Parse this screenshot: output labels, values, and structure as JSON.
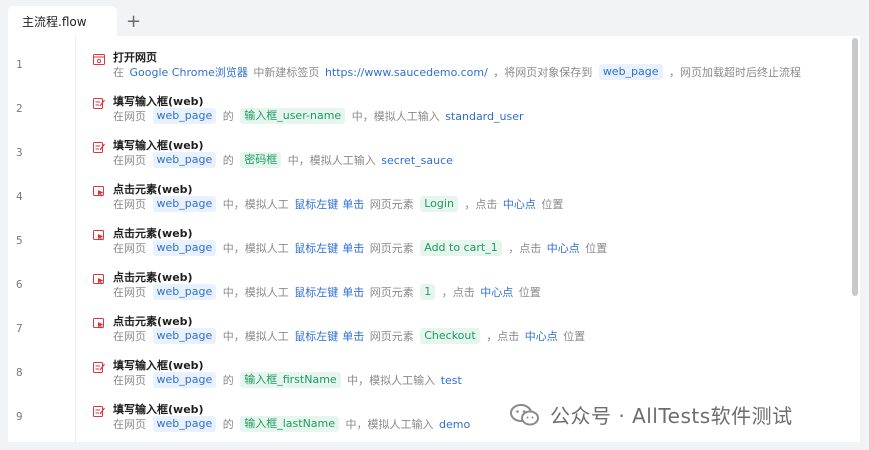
{
  "tabs": [
    {
      "label": "主流程.flow"
    }
  ],
  "tab_add": "+",
  "rows": [
    {
      "line": "1",
      "icon": "browser-icon",
      "title": "打开网页",
      "desc": [
        {
          "t": "text",
          "v": "在 "
        },
        {
          "t": "link",
          "v": "Google Chrome浏览器"
        },
        {
          "t": "text",
          "v": " 中新建标签页 "
        },
        {
          "t": "link",
          "v": "https://www.saucedemo.com/"
        },
        {
          "t": "text",
          "v": " ，将网页对象保存到 "
        },
        {
          "t": "chipb",
          "v": "web_page"
        },
        {
          "t": "text",
          "v": " ，网页加载超时后终止流程"
        }
      ]
    },
    {
      "line": "2",
      "icon": "edit-icon",
      "title": "填写输入框(web)",
      "desc": [
        {
          "t": "text",
          "v": "在网页 "
        },
        {
          "t": "chipb",
          "v": "web_page"
        },
        {
          "t": "text",
          "v": " 的 "
        },
        {
          "t": "chipg",
          "v": "输入框_user-name"
        },
        {
          "t": "text",
          "v": " 中，模拟人工输入 "
        },
        {
          "t": "link",
          "v": "standard_user"
        }
      ]
    },
    {
      "line": "3",
      "icon": "edit-icon",
      "title": "填写输入框(web)",
      "desc": [
        {
          "t": "text",
          "v": "在网页 "
        },
        {
          "t": "chipb",
          "v": "web_page"
        },
        {
          "t": "text",
          "v": " 的 "
        },
        {
          "t": "chipg",
          "v": "密码框"
        },
        {
          "t": "text",
          "v": " 中，模拟人工输入 "
        },
        {
          "t": "link",
          "v": "secret_sauce"
        }
      ]
    },
    {
      "line": "4",
      "icon": "click-icon",
      "title": "点击元素(web)",
      "desc": [
        {
          "t": "text",
          "v": "在网页 "
        },
        {
          "t": "chipb",
          "v": "web_page"
        },
        {
          "t": "text",
          "v": " 中，模拟人工 "
        },
        {
          "t": "link",
          "v": "鼠标左键"
        },
        {
          "t": "link",
          "v": "单击"
        },
        {
          "t": "text",
          "v": " 网页元素 "
        },
        {
          "t": "chipg",
          "v": "Login"
        },
        {
          "t": "text",
          "v": " ，点击 "
        },
        {
          "t": "link",
          "v": "中心点"
        },
        {
          "t": "text",
          "v": " 位置"
        }
      ]
    },
    {
      "line": "5",
      "icon": "click-icon",
      "title": "点击元素(web)",
      "desc": [
        {
          "t": "text",
          "v": "在网页 "
        },
        {
          "t": "chipb",
          "v": "web_page"
        },
        {
          "t": "text",
          "v": " 中，模拟人工 "
        },
        {
          "t": "link",
          "v": "鼠标左键"
        },
        {
          "t": "link",
          "v": "单击"
        },
        {
          "t": "text",
          "v": " 网页元素 "
        },
        {
          "t": "chipg",
          "v": "Add to cart_1"
        },
        {
          "t": "text",
          "v": " ，点击 "
        },
        {
          "t": "link",
          "v": "中心点"
        },
        {
          "t": "text",
          "v": " 位置"
        }
      ]
    },
    {
      "line": "6",
      "icon": "click-icon",
      "title": "点击元素(web)",
      "desc": [
        {
          "t": "text",
          "v": "在网页 "
        },
        {
          "t": "chipb",
          "v": "web_page"
        },
        {
          "t": "text",
          "v": " 中，模拟人工 "
        },
        {
          "t": "link",
          "v": "鼠标左键"
        },
        {
          "t": "link",
          "v": "单击"
        },
        {
          "t": "text",
          "v": " 网页元素 "
        },
        {
          "t": "chipg",
          "v": "1"
        },
        {
          "t": "text",
          "v": " ，点击 "
        },
        {
          "t": "link",
          "v": "中心点"
        },
        {
          "t": "text",
          "v": " 位置"
        }
      ]
    },
    {
      "line": "7",
      "icon": "click-icon",
      "title": "点击元素(web)",
      "desc": [
        {
          "t": "text",
          "v": "在网页 "
        },
        {
          "t": "chipb",
          "v": "web_page"
        },
        {
          "t": "text",
          "v": " 中，模拟人工 "
        },
        {
          "t": "link",
          "v": "鼠标左键"
        },
        {
          "t": "link",
          "v": "单击"
        },
        {
          "t": "text",
          "v": " 网页元素 "
        },
        {
          "t": "chipg",
          "v": "Checkout"
        },
        {
          "t": "text",
          "v": " ，点击 "
        },
        {
          "t": "link",
          "v": "中心点"
        },
        {
          "t": "text",
          "v": " 位置"
        }
      ]
    },
    {
      "line": "8",
      "icon": "edit-icon",
      "title": "填写输入框(web)",
      "desc": [
        {
          "t": "text",
          "v": "在网页 "
        },
        {
          "t": "chipb",
          "v": "web_page"
        },
        {
          "t": "text",
          "v": " 的 "
        },
        {
          "t": "chipg",
          "v": "输入框_firstName"
        },
        {
          "t": "text",
          "v": " 中，模拟人工输入 "
        },
        {
          "t": "link",
          "v": "test"
        }
      ]
    },
    {
      "line": "9",
      "icon": "edit-icon",
      "title": "填写输入框(web)",
      "desc": [
        {
          "t": "text",
          "v": "在网页 "
        },
        {
          "t": "chipb",
          "v": "web_page"
        },
        {
          "t": "text",
          "v": " 的 "
        },
        {
          "t": "chipg",
          "v": "输入框_lastName"
        },
        {
          "t": "text",
          "v": " 中，模拟人工输入 "
        },
        {
          "t": "link",
          "v": "demo"
        }
      ]
    }
  ],
  "watermark": "公众号 · AllTests软件测试",
  "colors": {
    "accent": "#2f6fd1",
    "green": "#1e9a62",
    "icon_red": "#d9363e"
  }
}
